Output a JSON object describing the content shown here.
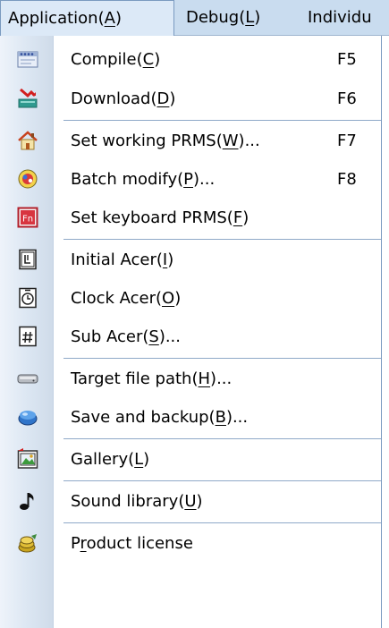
{
  "menubar": {
    "items": [
      {
        "prefix": "Application(",
        "key": "A",
        "suffix": ")"
      },
      {
        "prefix": "Debug(",
        "key": "L",
        "suffix": ")"
      },
      {
        "prefix": "Individu",
        "key": "",
        "suffix": ""
      }
    ]
  },
  "menu": {
    "items": [
      {
        "prefix": "Compile(",
        "key": "C",
        "suffix": ")",
        "shortcut": "F5",
        "icon": "compile-icon"
      },
      {
        "prefix": "Download(",
        "key": "D",
        "suffix": ")",
        "shortcut": "F6",
        "icon": "download-icon"
      },
      {
        "prefix": "Set working PRMS(",
        "key": "W",
        "suffix": ")...",
        "shortcut": "F7",
        "icon": "home-icon"
      },
      {
        "prefix": "Batch modify(",
        "key": "P",
        "suffix": ")...",
        "shortcut": "F8",
        "icon": "batch-modify-icon"
      },
      {
        "prefix": "Set keyboard PRMS(",
        "key": "F",
        "suffix": ")",
        "shortcut": "",
        "icon": "keyboard-fn-icon"
      },
      {
        "prefix": "Initial Acer(",
        "key": "I",
        "suffix": ")",
        "shortcut": "",
        "icon": "initial-acer-icon"
      },
      {
        "prefix": "Clock Acer(",
        "key": "O",
        "suffix": ")",
        "shortcut": "",
        "icon": "clock-acer-icon"
      },
      {
        "prefix": "Sub Acer(",
        "key": "S",
        "suffix": ")...",
        "shortcut": "",
        "icon": "sub-acer-icon"
      },
      {
        "prefix": "Target file path(",
        "key": "H",
        "suffix": ")...",
        "shortcut": "",
        "icon": "drive-icon"
      },
      {
        "prefix": "Save and backup(",
        "key": "B",
        "suffix": ")...",
        "shortcut": "",
        "icon": "save-backup-icon"
      },
      {
        "prefix": "Gallery(",
        "key": "L",
        "suffix": ")",
        "shortcut": "",
        "icon": "gallery-icon"
      },
      {
        "prefix": "Sound library(",
        "key": "U",
        "suffix": ")",
        "shortcut": "",
        "icon": "music-note-icon"
      },
      {
        "prefix": "P",
        "key": "r",
        "suffix": "oduct license",
        "shortcut": "",
        "icon": "license-icon"
      }
    ]
  },
  "colors": {
    "menubar_bg": "#c9dcef",
    "gutter_bg": "#dbe6f2",
    "separator": "#8fa9c8",
    "active_border": "#7a9ac0"
  }
}
